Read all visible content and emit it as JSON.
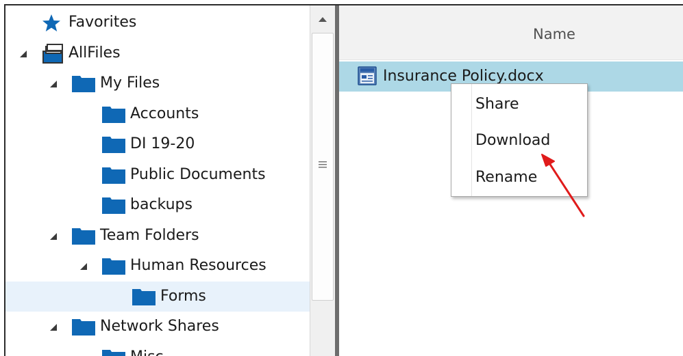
{
  "tree": {
    "items": [
      {
        "label": "Favorites",
        "level": 0,
        "icon": "star-icon",
        "expanded": null,
        "selected": false
      },
      {
        "label": "AllFiles",
        "level": 0,
        "icon": "all-files-icon",
        "expanded": true,
        "selected": false
      },
      {
        "label": "My Files",
        "level": 1,
        "icon": "folder-icon",
        "expanded": true,
        "selected": false
      },
      {
        "label": "Accounts",
        "level": 2,
        "icon": "folder-icon",
        "expanded": null,
        "selected": false
      },
      {
        "label": "DI 19-20",
        "level": 2,
        "icon": "folder-icon",
        "expanded": null,
        "selected": false
      },
      {
        "label": "Public Documents",
        "level": 2,
        "icon": "folder-icon",
        "expanded": null,
        "selected": false
      },
      {
        "label": "backups",
        "level": 2,
        "icon": "folder-icon",
        "expanded": null,
        "selected": false
      },
      {
        "label": "Team Folders",
        "level": 1,
        "icon": "folder-icon",
        "expanded": true,
        "selected": false
      },
      {
        "label": "Human Resources",
        "level": 2,
        "icon": "folder-icon",
        "expanded": true,
        "selected": false
      },
      {
        "label": "Forms",
        "level": 3,
        "icon": "folder-icon",
        "expanded": null,
        "selected": true
      },
      {
        "label": "Network Shares",
        "level": 1,
        "icon": "folder-icon",
        "expanded": true,
        "selected": false
      },
      {
        "label": "Misc",
        "level": 2,
        "icon": "folder-icon",
        "expanded": null,
        "selected": false
      }
    ]
  },
  "file_list": {
    "column_header": "Name",
    "files": [
      {
        "name": "Insurance Policy.docx",
        "icon": "word-document-icon",
        "selected": true
      }
    ]
  },
  "context_menu": {
    "items": [
      "Share",
      "Download",
      "Rename"
    ]
  },
  "colors": {
    "folder": "#0f68b5",
    "selected_file_row": "#add8e6",
    "selected_tree_row": "#e8f2fb",
    "annotation_arrow": "#e01b1b"
  }
}
